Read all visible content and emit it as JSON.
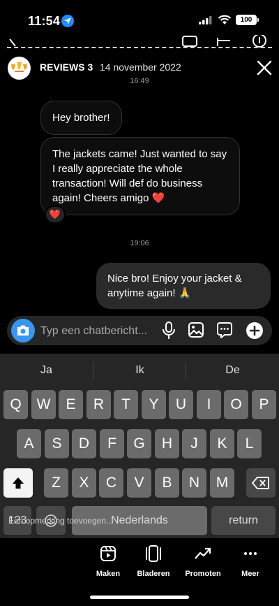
{
  "status_bar": {
    "time": "11:54",
    "battery": "100"
  },
  "story": {
    "account": "REVIEWS 3",
    "date": "14 november 2022"
  },
  "chat": {
    "time1": "16:49",
    "msg1": "Hey brother!",
    "msg2": "The jackets came! Just wanted to say I really appreciate the whole transaction! Will def do business again! Cheers amigo ❤️",
    "reaction": "❤️",
    "time2": "19:06",
    "msg3": "Nice bro! Enjoy your jacket & anytime again! 🙏"
  },
  "composer": {
    "placeholder": "Typ een chatbericht..."
  },
  "keyboard": {
    "suggestions": [
      "Ja",
      "Ik",
      "De"
    ],
    "row1": [
      "Q",
      "W",
      "E",
      "R",
      "T",
      "Y",
      "U",
      "I",
      "O",
      "P"
    ],
    "row2": [
      "A",
      "S",
      "D",
      "F",
      "G",
      "H",
      "J",
      "K",
      "L"
    ],
    "row3": [
      "Z",
      "X",
      "C",
      "V",
      "B",
      "N",
      "M"
    ],
    "key_123": "123",
    "space": "Nederlands",
    "return": "return"
  },
  "overlay_tip": "Een opmerking toevoegen...",
  "tools": [
    {
      "label": "Maken",
      "icon": "reels-icon"
    },
    {
      "label": "Bladeren",
      "icon": "carousel-icon"
    },
    {
      "label": "Promoten",
      "icon": "trend-icon"
    },
    {
      "label": "Meer",
      "icon": "more-icon"
    }
  ],
  "colors": {
    "accent": "#3797f0",
    "heart": "#ff2d4a",
    "keyboard_bg": "#262626",
    "key": "#6b6b6b"
  }
}
